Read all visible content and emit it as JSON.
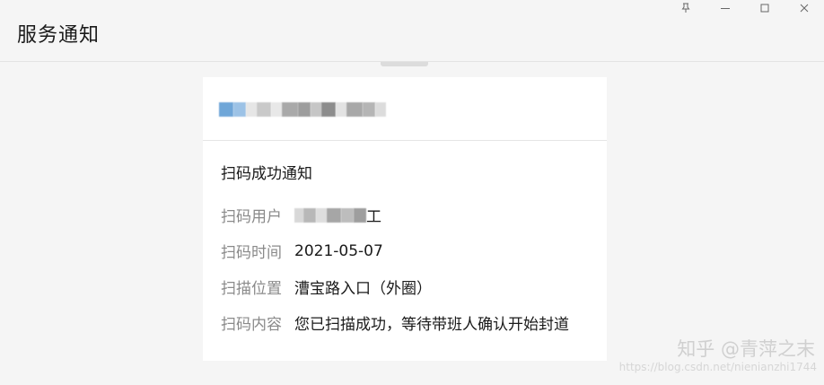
{
  "window": {
    "title": "服务通知",
    "controls": [
      "pin-icon",
      "minimize-icon",
      "maximize-icon",
      "close-icon"
    ]
  },
  "card": {
    "sender_name_suffix": "",
    "title": "扫码成功通知",
    "fields": [
      {
        "label": "扫码用户",
        "value": "工"
      },
      {
        "label": "扫码时间",
        "value": "2021-05-07"
      },
      {
        "label": "扫描位置",
        "value": "漕宝路入口（外圈）"
      },
      {
        "label": "扫码内容",
        "value": "您已扫描成功，等待带班人确认开始封道"
      }
    ]
  },
  "watermark": {
    "text": "知乎 @青萍之末",
    "url": "https://blog.csdn.net/nienianzhi1744"
  },
  "colors": {
    "background": "#f5f5f5",
    "card": "#ffffff",
    "label": "#8a8a8a",
    "text": "#1a1a1a"
  }
}
